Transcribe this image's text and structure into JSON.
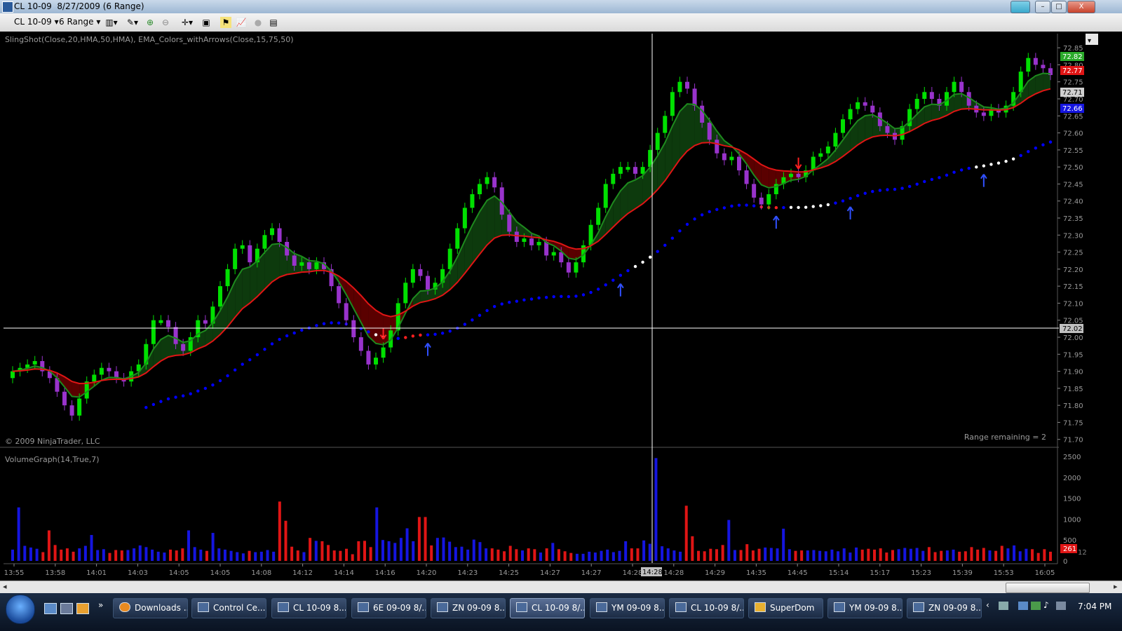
{
  "window": {
    "title": "CL 10-09  8/27/2009 (6 Range)"
  },
  "toolbar": {
    "instrument": "CL 10-09",
    "period": "6 Range"
  },
  "chart": {
    "indicator_label": "SlingShot(Close,20,HMA,50,HMA), EMA_Colors_withArrows(Close,15,75,50)",
    "copyright": "© 2009 NinjaTrader, LLC",
    "range_remaining": "Range remaining = 2",
    "volume_label": "VolumeGraph(14,True,7)",
    "crosshair_price": "72.02",
    "crosshair_time": "14:28",
    "price_badges": {
      "green": "72.82",
      "red": "72.77",
      "gray": "72.71",
      "blue": "72.66"
    },
    "volume_badges": {
      "red": "261",
      "gray": "12"
    },
    "colors": {
      "up": "#00e000",
      "down": "#9933cc",
      "fill_green": "#0d3a0d",
      "fill_red": "#5a0000",
      "dots": "#0000ff",
      "vol_up": "#1515e0",
      "vol_down": "#e01515"
    }
  },
  "chart_data": {
    "type": "candlestick",
    "price_axis": {
      "ticks": [
        "72.85",
        "72.80",
        "72.75",
        "72.70",
        "72.65",
        "72.60",
        "72.55",
        "72.50",
        "72.45",
        "72.40",
        "72.35",
        "72.30",
        "72.25",
        "72.20",
        "72.15",
        "72.10",
        "72.05",
        "72.00",
        "71.95",
        "71.90",
        "71.85",
        "71.80",
        "71.75",
        "71.70"
      ],
      "ylim": [
        71.685,
        72.875
      ]
    },
    "volume_axis": {
      "ticks": [
        "2500",
        "2000",
        "1500",
        "1000",
        "500",
        "0"
      ],
      "ylim": [
        0,
        2600
      ]
    },
    "time_axis": {
      "ticks": [
        "13:55",
        "13:58",
        "14:01",
        "14:03",
        "14:05",
        "14:05",
        "14:08",
        "14:12",
        "14:14",
        "14:16",
        "14:20",
        "14:23",
        "14:25",
        "14:27",
        "14:27",
        "14:28",
        "14:28",
        "14:29",
        "14:35",
        "14:45",
        "15:14",
        "15:17",
        "15:23",
        "15:39",
        "15:53",
        "16:05"
      ]
    },
    "close_path": [
      71.9,
      71.91,
      71.92,
      71.93,
      71.9,
      71.88,
      71.84,
      71.8,
      71.77,
      71.82,
      71.87,
      71.89,
      71.91,
      71.9,
      71.88,
      71.87,
      71.9,
      71.92,
      71.98,
      72.05,
      72.05,
      72.03,
      71.98,
      71.96,
      72.0,
      72.05,
      72.04,
      72.09,
      72.15,
      72.2,
      72.26,
      72.27,
      72.22,
      72.26,
      72.3,
      72.32,
      72.28,
      72.24,
      72.21,
      72.22,
      72.2,
      72.22,
      72.2,
      72.15,
      72.1,
      72.05,
      72.0,
      71.96,
      71.92,
      71.94,
      71.97,
      72.02,
      72.1,
      72.16,
      72.2,
      72.18,
      72.14,
      72.16,
      72.2,
      72.26,
      72.32,
      72.38,
      72.42,
      72.45,
      72.47,
      72.44,
      72.36,
      72.31,
      72.28,
      72.29,
      72.27,
      72.28,
      72.24,
      72.25,
      72.22,
      72.19,
      72.22,
      72.27,
      72.33,
      72.38,
      72.45,
      72.48,
      72.5,
      72.5,
      72.48,
      72.5,
      72.55,
      72.6,
      72.65,
      72.72,
      72.75,
      72.73,
      72.68,
      72.63,
      72.58,
      72.54,
      72.52,
      72.53,
      72.49,
      72.45,
      72.41,
      72.39,
      72.42,
      72.45,
      72.47,
      72.48,
      72.47,
      72.49,
      72.53,
      72.54,
      72.56,
      72.6,
      72.64,
      72.67,
      72.69,
      72.68,
      72.66,
      72.62,
      72.6,
      72.58,
      72.62,
      72.67,
      72.7,
      72.72,
      72.7,
      72.68,
      72.72,
      72.75,
      72.72,
      72.68,
      72.66,
      72.65,
      72.67,
      72.66,
      72.68,
      72.72,
      72.78,
      72.82,
      72.8,
      72.79,
      72.77
    ],
    "volume": [
      270,
      1280,
      360,
      320,
      290,
      210,
      730,
      380,
      270,
      300,
      220,
      300,
      360,
      620,
      260,
      280,
      190,
      260,
      250,
      260,
      300,
      370,
      330,
      270,
      220,
      200,
      270,
      250,
      300,
      730,
      330,
      270,
      240,
      670,
      300,
      270,
      240,
      210,
      180,
      240,
      210,
      220,
      260,
      220,
      1420,
      960,
      340,
      250,
      210,
      550,
      480,
      470,
      380,
      250,
      240,
      290,
      160,
      470,
      480,
      330,
      1280,
      500,
      470,
      430,
      550,
      780,
      470,
      1050,
      1050,
      370,
      550,
      560,
      460,
      330,
      340,
      270,
      510,
      450,
      300,
      300,
      270,
      230,
      360,
      280,
      250,
      300,
      280,
      200,
      300,
      430,
      280,
      230,
      190,
      170,
      170,
      220,
      200,
      240,
      270,
      210,
      240,
      470,
      300,
      300,
      490,
      410,
      2460,
      350,
      300,
      250,
      220,
      1320,
      590,
      240,
      230,
      290,
      280,
      380,
      980,
      260,
      260,
      400,
      250,
      290,
      320,
      310,
      300,
      770,
      280,
      240,
      250,
      250,
      260,
      240,
      230,
      270,
      230,
      300,
      200,
      320,
      270,
      290,
      270,
      300,
      200,
      260,
      280,
      310,
      290,
      310,
      240,
      330,
      210,
      240,
      250,
      270,
      220,
      230,
      330,
      270,
      310,
      250,
      240,
      360,
      300,
      370,
      230,
      290,
      280,
      190,
      280,
      220
    ]
  },
  "taskbar": {
    "items": [
      "Downloads ...",
      "Control Ce...",
      "CL 10-09 8...",
      "6E 09-09 8/...",
      "ZN 09-09 8...",
      "CL 10-09 8/...",
      "YM 09-09 8...",
      "CL 10-09 8/...",
      "SuperDom",
      "YM 09-09 8...",
      "ZN 09-09 8..."
    ],
    "clock": "7:04 PM"
  }
}
